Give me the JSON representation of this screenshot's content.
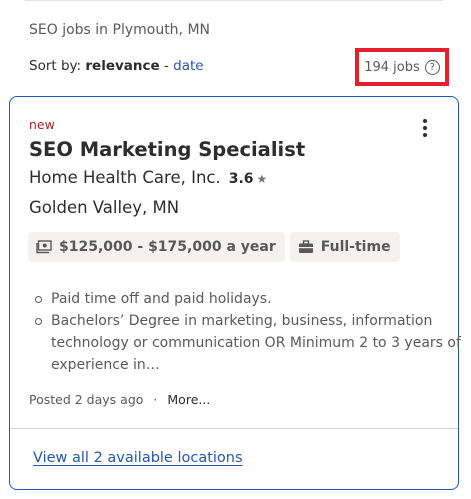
{
  "search": {
    "title": "SEO jobs in Plymouth, MN"
  },
  "sort": {
    "prefix": "Sort by:",
    "active": "relevance",
    "separator": "-",
    "alternate": "date"
  },
  "results": {
    "count_label": "194 jobs",
    "help_icon": "question-circle-icon"
  },
  "job": {
    "badge": "new",
    "title": "SEO Marketing Specialist",
    "company": "Home Health Care, Inc.",
    "rating": "3.6",
    "location": "Golden Valley, MN",
    "salary": "$125,000 - $175,000 a year",
    "job_type": "Full-time",
    "snippet": [
      "Paid time off and paid holidays.",
      "Bachelors’ Degree in marketing, business, information technology or communication OR Minimum 2 to 3 years of experience in…"
    ],
    "posted": "Posted 2 days ago",
    "meta_separator": "·",
    "more_label": "More...",
    "view_all_locations": "View all 2 available locations"
  },
  "colors": {
    "highlight_border": "#e5202e",
    "card_border": "#1e5bb0",
    "link": "#2557a7",
    "new_badge": "#a9252b"
  }
}
